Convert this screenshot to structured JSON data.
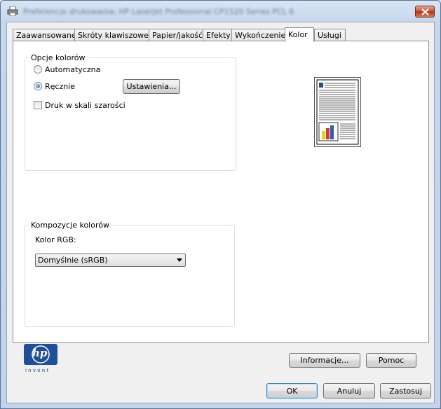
{
  "window": {
    "title": "Preferencje drukowania: HP LaserJet Professional CP1520 Series PCL 6"
  },
  "tabs": [
    {
      "label": "Zaawansowane",
      "active": false
    },
    {
      "label": "Skróty klawiszowe",
      "active": false
    },
    {
      "label": "Papier/jakość",
      "active": false
    },
    {
      "label": "Efekty",
      "active": false
    },
    {
      "label": "Wykończenie",
      "active": false
    },
    {
      "label": "Kolor",
      "active": true
    },
    {
      "label": "Usługi",
      "active": false
    }
  ],
  "color_options": {
    "group_label": "Opcje kolorów",
    "automatic_label": "Automatyczna",
    "manual_label": "Ręcznie",
    "selected": "manual",
    "settings_button": "Ustawienia...",
    "grayscale_label": "Druk w skali szarości",
    "grayscale_checked": false
  },
  "color_themes": {
    "group_label": "Kompozycje kolorów",
    "rgb_label": "Kolor RGB:",
    "rgb_value": "Domyślnie (sRGB)"
  },
  "logo": {
    "text": "hp",
    "tagline": "i n v e n t"
  },
  "buttons": {
    "info": "Informacje...",
    "help": "Pomoc",
    "ok": "OK",
    "cancel": "Anuluj",
    "apply": "Zastosuj"
  },
  "colors": {
    "accent": "#1c5fb8",
    "hp_blue": "#1f4f9a",
    "close_red": "#c7492b"
  }
}
